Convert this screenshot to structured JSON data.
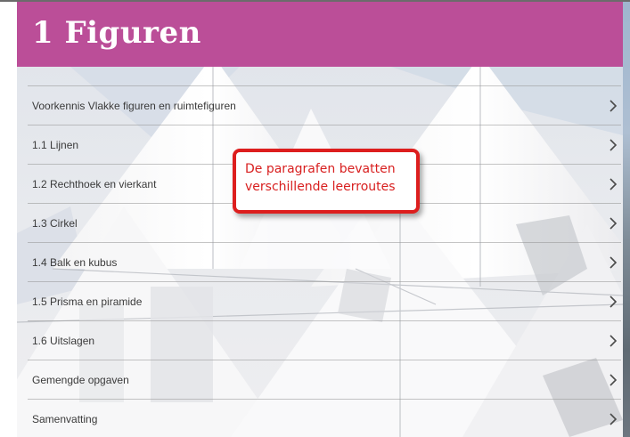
{
  "header": {
    "title": "1 Figuren",
    "background_color": "#bb4e98",
    "text_color": "#ffffff"
  },
  "menu": {
    "items": [
      {
        "label": "Voorkennis Vlakke figuren en ruimtefiguren",
        "icon": "chevron-right-icon"
      },
      {
        "label": "1.1 Lijnen",
        "icon": "chevron-right-icon"
      },
      {
        "label": "1.2 Rechthoek en vierkant",
        "icon": "chevron-right-icon"
      },
      {
        "label": "1.3 Cirkel",
        "icon": "chevron-right-icon"
      },
      {
        "label": "1.4 Balk en kubus",
        "icon": "chevron-right-icon"
      },
      {
        "label": "1.5 Prisma en piramide",
        "icon": "chevron-right-icon"
      },
      {
        "label": "1.6 Uitslagen",
        "icon": "chevron-right-icon"
      },
      {
        "label": "Gemengde opgaven",
        "icon": "chevron-right-icon"
      },
      {
        "label": "Samenvatting",
        "icon": "chevron-right-icon"
      }
    ]
  },
  "callout": {
    "line1": "De paragrafen bevatten",
    "line2": "verschillende leerroutes",
    "border_color": "#dd1e1e",
    "text_color": "#d81f1f"
  }
}
